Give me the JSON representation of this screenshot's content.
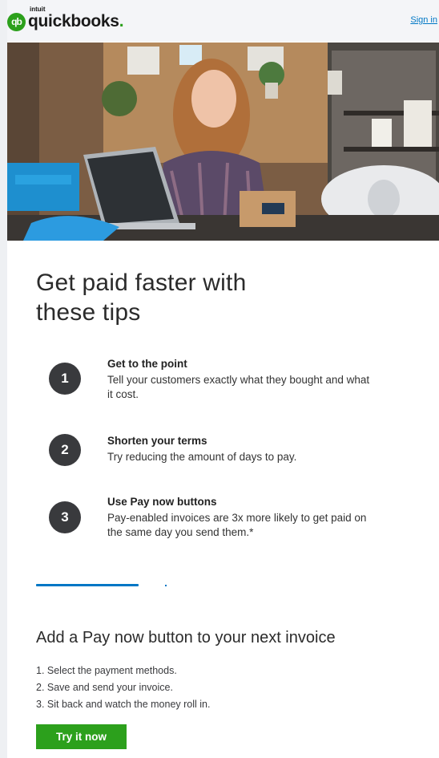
{
  "header": {
    "logo_badge": "qb",
    "logo_small": "intuit",
    "logo_brand": "quickbooks",
    "logo_dot": ".",
    "sign_in": "Sign in"
  },
  "hero": {
    "image": "woman-at-laptop-packing-orders"
  },
  "headline": {
    "line1": "Get paid faster with",
    "line2": "these tips"
  },
  "tips": [
    {
      "number": "1",
      "title": "Get to the point",
      "desc": "Tell your customers exactly what they bought and what it cost."
    },
    {
      "number": "2",
      "title": "Shorten your terms",
      "desc": "Try reducing the amount of days to pay."
    },
    {
      "number": "3",
      "title": "Use Pay now buttons",
      "desc": "Pay-enabled invoices are 3x more likely to get paid on the same day you send them.*"
    }
  ],
  "cta": {
    "title": "Add a Pay now button to your next invoice",
    "steps": [
      "1. Select the payment methods.",
      "2. Save and send your invoice.",
      "3. Sit back and watch the money roll in."
    ],
    "button": "Try it now"
  },
  "colors": {
    "brand_green": "#2ca01c",
    "link_blue": "#0077c5",
    "dark_circle": "#393a3d"
  }
}
